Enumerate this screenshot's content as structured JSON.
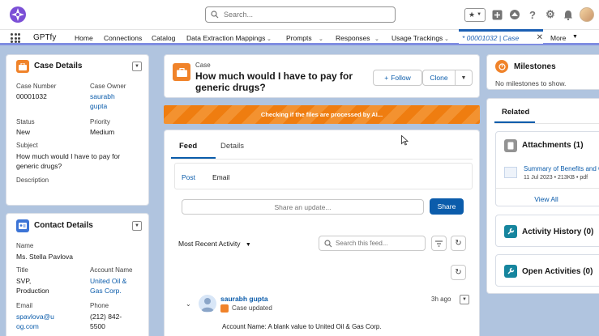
{
  "header": {
    "search_placeholder": "Search..."
  },
  "nav": {
    "app_name": "GPTfy",
    "items": [
      "Home",
      "Connections",
      "Catalog",
      "Data Extraction Mappings",
      "Prompts",
      "Responses",
      "Usage Trackings"
    ],
    "active_tab": "* 00001032 | Case",
    "more": "More"
  },
  "case_details": {
    "title": "Case Details",
    "case_number_label": "Case Number",
    "case_number": "00001032",
    "case_owner_label": "Case Owner",
    "case_owner_line1": "saurabh",
    "case_owner_line2": "gupta",
    "status_label": "Status",
    "status": "New",
    "priority_label": "Priority",
    "priority": "Medium",
    "subject_label": "Subject",
    "subject_line1": "How much would I have to pay for",
    "subject_line2": "generic drugs?",
    "description_label": "Description"
  },
  "contact_details": {
    "title": "Contact Details",
    "name_label": "Name",
    "name": "Ms. Stella Pavlova",
    "title_label": "Title",
    "title_line1": "SVP,",
    "title_line2": "Production",
    "account_label": "Account Name",
    "account_line1": "United Oil &",
    "account_line2": "Gas Corp.",
    "email_label": "Email",
    "email_line1": "spavlova@u",
    "email_line2": "og.com",
    "phone_label": "Phone",
    "phone_line1": "(212) 842-",
    "phone_line2": "5500"
  },
  "case_header": {
    "object_label": "Case",
    "title_line1": "How much would I have to pay for",
    "title_line2": "generic drugs?",
    "follow_label": "Follow",
    "clone_label": "Clone"
  },
  "banner": {
    "text": "Checking if the files are processed by AI..."
  },
  "feed": {
    "tabs": [
      "Feed",
      "Details"
    ],
    "post_tab": "Post",
    "email_tab": "Email",
    "share_placeholder": "Share an update...",
    "share_button": "Share",
    "sort_label": "Most Recent Activity",
    "search_placeholder": "Search this feed...",
    "item": {
      "author": "saurabh gupta",
      "action": "Case updated",
      "time": "3h ago",
      "detail": "Account Name: A blank value to United Oil & Gas Corp."
    }
  },
  "milestones": {
    "title": "Milestones",
    "empty_text": "No milestones to show."
  },
  "related": {
    "tab": "Related",
    "attachments_title": "Attachments (1)",
    "attachment_name": "Summary of Benefits and C",
    "attachment_meta": "11 Jul 2023  •  213KB  •  pdf",
    "view_all": "View All",
    "activity_history": "Activity History (0)",
    "open_activities": "Open Activities (0)"
  },
  "colors": {
    "brand_blue": "#0b5cab",
    "case_orange": "#f0832a",
    "contact_blue": "#3c74d6",
    "banner_orange": "#ef7d10",
    "related_green": "#16859e"
  }
}
